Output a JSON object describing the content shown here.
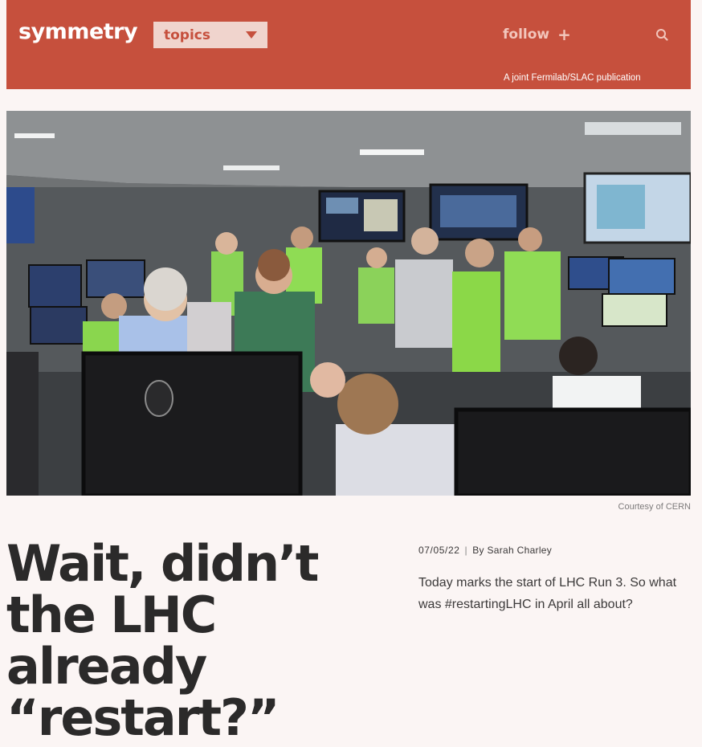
{
  "header": {
    "logo": "symmetry",
    "topics_label": "topics",
    "follow_label": "follow",
    "follow_icon": "plus-icon",
    "search_icon": "search-icon",
    "tagline": "A joint Fermilab/SLAC publication",
    "colors": {
      "bar": "#c6503d",
      "topics_bg": "#f0d4cd"
    }
  },
  "hero": {
    "image_description": "Group of people in a particle-accelerator control room with many monitors",
    "caption": "Courtesy of CERN"
  },
  "article": {
    "headline": "Wait, didn’t the LHC already “restart?”",
    "date": "07/05/22",
    "separator": "|",
    "byline": "By Sarah Charley",
    "summary": "Today marks the start of LHC Run 3. So what was #restartingLHC in April all about?"
  }
}
